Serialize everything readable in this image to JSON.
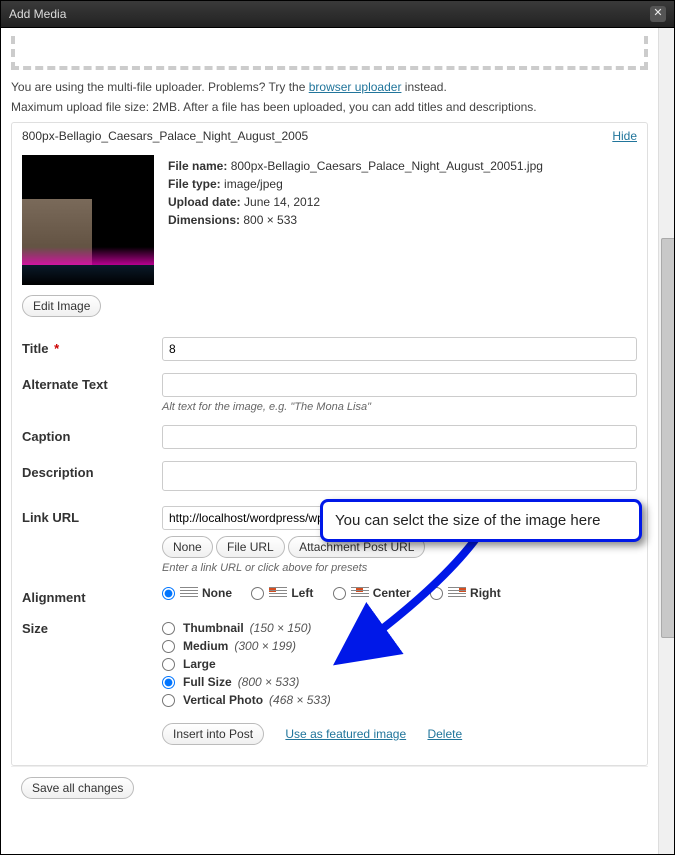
{
  "modal": {
    "title": "Add Media"
  },
  "uploader": {
    "info_prefix": "You are using the multi-file uploader. Problems? Try the ",
    "info_link": "browser uploader",
    "info_suffix": " instead.",
    "max_size": "Maximum upload file size: 2MB. After a file has been uploaded, you can add titles and descriptions."
  },
  "item": {
    "filename_short": "800px-Bellagio_Caesars_Palace_Night_August_2005",
    "hide_label": "Hide",
    "meta": {
      "file_name_label": "File name:",
      "file_name": "800px-Bellagio_Caesars_Palace_Night_August_20051.jpg",
      "file_type_label": "File type:",
      "file_type": "image/jpeg",
      "upload_date_label": "Upload date:",
      "upload_date": "June 14, 2012",
      "dimensions_label": "Dimensions:",
      "dimensions": "800 × 533"
    },
    "edit_image_label": "Edit Image"
  },
  "form": {
    "title_label": "Title",
    "title_value": "8",
    "alt_label": "Alternate Text",
    "alt_hint": "Alt text for the image, e.g. \"The Mona Lisa\"",
    "caption_label": "Caption",
    "description_label": "Description",
    "link_url_label": "Link URL",
    "link_url_value": "http://localhost/wordpress/wp-content/uploads/2012/06/800px-Bellagio_Caesars_P",
    "link_none": "None",
    "link_file": "File URL",
    "link_post": "Attachment Post URL",
    "link_hint": "Enter a link URL or click above for presets",
    "alignment_label": "Alignment",
    "align": {
      "none": "None",
      "left": "Left",
      "center": "Center",
      "right": "Right"
    },
    "size_label": "Size",
    "sizes": {
      "thumbnail": {
        "name": "Thumbnail",
        "dim": "(150 × 150)"
      },
      "medium": {
        "name": "Medium",
        "dim": "(300 × 199)"
      },
      "large": {
        "name": "Large",
        "dim": ""
      },
      "full": {
        "name": "Full Size",
        "dim": "(800 × 533)"
      },
      "vertical": {
        "name": "Vertical Photo",
        "dim": "(468 × 533)"
      }
    },
    "insert_label": "Insert into Post",
    "featured_label": "Use as featured image",
    "delete_label": "Delete"
  },
  "footer": {
    "save_label": "Save all changes"
  },
  "callout": {
    "text": "You can selct the size of the image here"
  }
}
